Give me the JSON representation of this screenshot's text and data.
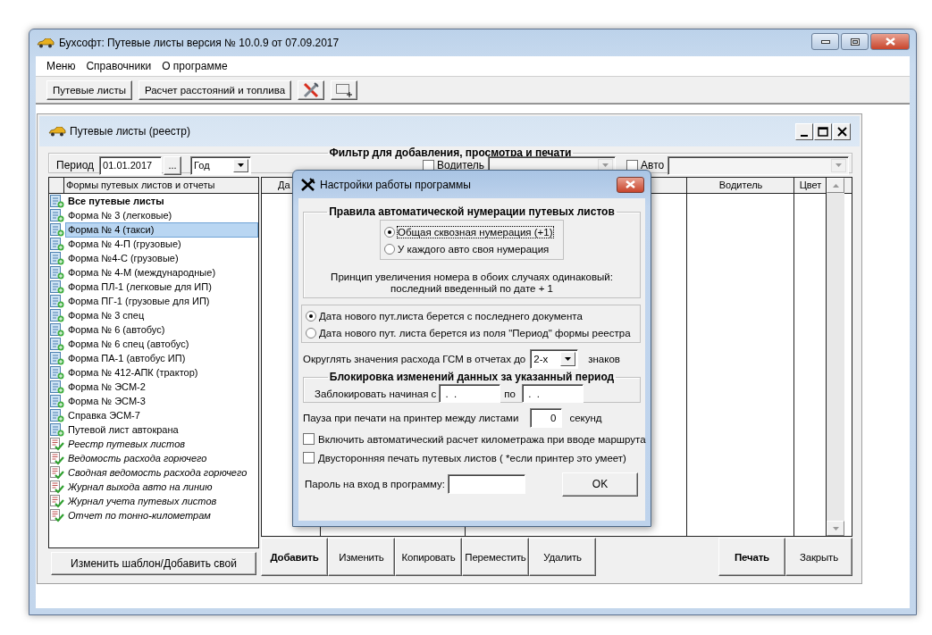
{
  "window": {
    "title": "Бухсофт: Путевые листы версия № 10.0.9 от 07.09.2017"
  },
  "menu": [
    {
      "label": "Меню"
    },
    {
      "label": "Справочники"
    },
    {
      "label": "О программе"
    }
  ],
  "toolbar": {
    "buttons": [
      {
        "kind": "text",
        "label": "Путевые листы"
      },
      {
        "kind": "text",
        "label": "Расчет расстояний и топлива"
      },
      {
        "kind": "tools"
      },
      {
        "kind": "selection"
      }
    ]
  },
  "registry": {
    "title": "Путевые листы (реестр)",
    "filter": {
      "title": "Фильтр для добавления, просмотра и печати",
      "period_label": "Период",
      "period_value": "01.01.2017",
      "browse_button": "...",
      "period_type": "Год",
      "driver": {
        "label": "Водитель",
        "checked": false
      },
      "auto": {
        "label": "Авто",
        "checked": false
      }
    },
    "forms": {
      "header": "Формы путевых листов и отчеты",
      "items": [
        {
          "kind": "all",
          "label": "Все путевые листы",
          "selected": false
        },
        {
          "kind": "form",
          "label": "Форма № 3 (легковые)",
          "selected": false
        },
        {
          "kind": "form",
          "label": "Форма № 4 (такси)",
          "selected": true
        },
        {
          "kind": "form",
          "label": "Форма № 4-П (грузовые)",
          "selected": false
        },
        {
          "kind": "form",
          "label": "Форма №4-С (грузовые)",
          "selected": false
        },
        {
          "kind": "form",
          "label": "Форма № 4-М (международные)",
          "selected": false
        },
        {
          "kind": "form",
          "label": "Форма ПЛ-1 (легковые для ИП)",
          "selected": false
        },
        {
          "kind": "form",
          "label": "Форма ПГ-1 (грузовые для ИП)",
          "selected": false
        },
        {
          "kind": "form",
          "label": "Форма № 3 спец",
          "selected": false
        },
        {
          "kind": "form",
          "label": "Форма № 6 (автобус)",
          "selected": false
        },
        {
          "kind": "form",
          "label": "Форма № 6 спец (автобус)",
          "selected": false
        },
        {
          "kind": "form",
          "label": "Форма ПА-1 (автобус ИП)",
          "selected": false
        },
        {
          "kind": "form",
          "label": "Форма № 412-АПК (трактор)",
          "selected": false
        },
        {
          "kind": "form",
          "label": "Форма № ЭСМ-2",
          "selected": false
        },
        {
          "kind": "form",
          "label": "Форма № ЭСМ-3",
          "selected": false
        },
        {
          "kind": "form",
          "label": "Справка ЭСМ-7",
          "selected": false
        },
        {
          "kind": "form",
          "label": "Путевой лист автокрана",
          "selected": false
        },
        {
          "kind": "report",
          "label": "Реестр путевых листов",
          "selected": false
        },
        {
          "kind": "report",
          "label": "Ведомость расхода горючего",
          "selected": false
        },
        {
          "kind": "report",
          "label": "Сводная ведомость расхода горючего",
          "selected": false
        },
        {
          "kind": "report",
          "label": "Журнал выхода авто на линию",
          "selected": false
        },
        {
          "kind": "report",
          "label": "Журнал учета путевых листов",
          "selected": false
        },
        {
          "kind": "report",
          "label": "Отчет по тонно-километрам",
          "selected": false
        }
      ]
    },
    "template_button": "Изменить шаблон/Добавить свой",
    "table": {
      "columns": [
        {
          "label": "Да"
        },
        {
          "label": "Водитель"
        },
        {
          "label": "Цвет"
        }
      ]
    },
    "actions": [
      {
        "label": "Добавить",
        "default": true
      },
      {
        "label": "Изменить",
        "default": false
      },
      {
        "label": "Копировать",
        "default": false
      },
      {
        "label": "Переместить",
        "default": false
      },
      {
        "label": "Удалить",
        "default": false
      }
    ],
    "print_actions": [
      {
        "label": "Печать",
        "default": true
      },
      {
        "label": "Закрыть",
        "default": false
      }
    ]
  },
  "settings_dialog": {
    "title": "Настройки работы программы",
    "numbering": {
      "title": "Правила автоматической нумерации путевых листов",
      "options": [
        {
          "label": "Общая сквозная нумерация (+1)",
          "selected": true
        },
        {
          "label": "У каждого авто своя нумерация",
          "selected": false
        }
      ],
      "note": "Принцип увеличения номера в обоих случаях одинаковый:\nпоследний введенный по дате + 1"
    },
    "date_options": [
      {
        "label": "Дата нового пут.листа берется с последнего документа",
        "selected": true
      },
      {
        "label": "Дата нового пут. листа берется из поля \"Период\"  формы реестра",
        "selected": false
      }
    ],
    "rounding": {
      "label": "Округлять значения расхода ГСМ в отчетах до",
      "value": "2-х",
      "suffix": "знаков"
    },
    "lock": {
      "title": "Блокировка изменений данных за указанный период",
      "from_label": "Заблокировать начиная с",
      "from_value": " .  .",
      "to_label": "по",
      "to_value": " .  ."
    },
    "pause": {
      "label": "Пауза при печати на принтер между листами",
      "value": "0",
      "suffix": "секунд"
    },
    "checkboxes": [
      {
        "label": "Включить автоматический расчет километража при вводе маршрута",
        "checked": false
      },
      {
        "label": "Двусторонняя печать путевых листов ( *если принтер это умеет)",
        "checked": false
      }
    ],
    "password_label": "Пароль на вход в программу:",
    "ok_button": "OK"
  }
}
